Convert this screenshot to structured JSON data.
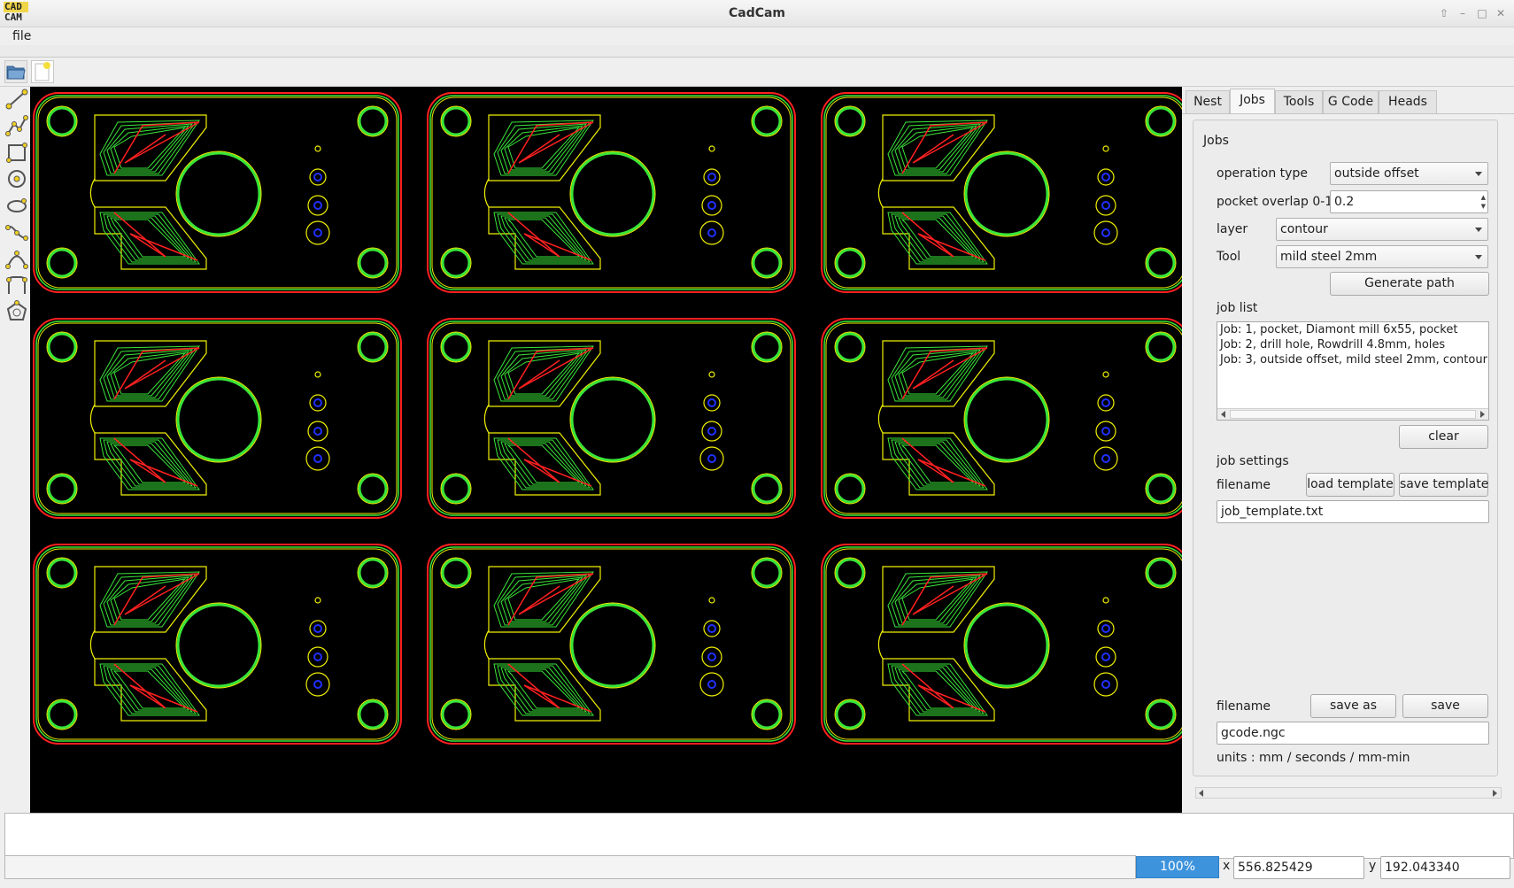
{
  "window": {
    "title": "CadCam",
    "logo_line1": "CAD",
    "logo_line2": "CAM"
  },
  "menu": {
    "file": "file"
  },
  "tabs": [
    {
      "label": "Nest"
    },
    {
      "label": "Jobs",
      "active": true
    },
    {
      "label": "Tools"
    },
    {
      "label": "G Code"
    },
    {
      "label": "Heads"
    }
  ],
  "jobs_panel": {
    "group_title": "Jobs",
    "operation_type_label": "operation type",
    "operation_type_value": "outside offset",
    "pocket_overlap_label": "pocket overlap 0-1",
    "pocket_overlap_value": "0.2",
    "layer_label": "layer",
    "layer_value": "contour",
    "tool_label": "Tool",
    "tool_value": "mild steel 2mm",
    "generate_path": "Generate path",
    "job_list_label": "job list",
    "job_list": [
      "Job: 1, pocket, Diamont mill 6x55, pocket",
      "Job: 2, drill hole, Rowdrill 4.8mm, holes",
      "Job: 3, outside offset, mild steel 2mm, contour"
    ],
    "clear": "clear",
    "job_settings_label": "job settings",
    "settings_filename_label": "filename",
    "load_template": "load template",
    "save_template": "save template",
    "template_filename": "job_template.txt",
    "output_filename_label": "filename",
    "save_as": "save as",
    "save": "save",
    "output_filename": "gcode.ngc",
    "units": "units : mm / seconds / mm-min"
  },
  "status": {
    "zoom": "100%",
    "x_label": "x",
    "x_value": "556.825429",
    "y_label": "y",
    "y_value": "192.043340"
  },
  "colors": {
    "canvas_bg": "#000000",
    "contour_red": "#ff2020",
    "path_green": "#39e639",
    "yellow": "#f0f000",
    "hole_blue": "#2030ff"
  },
  "icons": [
    "open-folder-icon",
    "new-file-icon",
    "line-tool-icon",
    "polyline-tool-icon",
    "rectangle-tool-icon",
    "circle-tool-icon",
    "ellipse-tool-icon",
    "bezier-tool-icon",
    "spline-tool-icon",
    "fillet-tool-icon",
    "polygon-tool-icon"
  ]
}
